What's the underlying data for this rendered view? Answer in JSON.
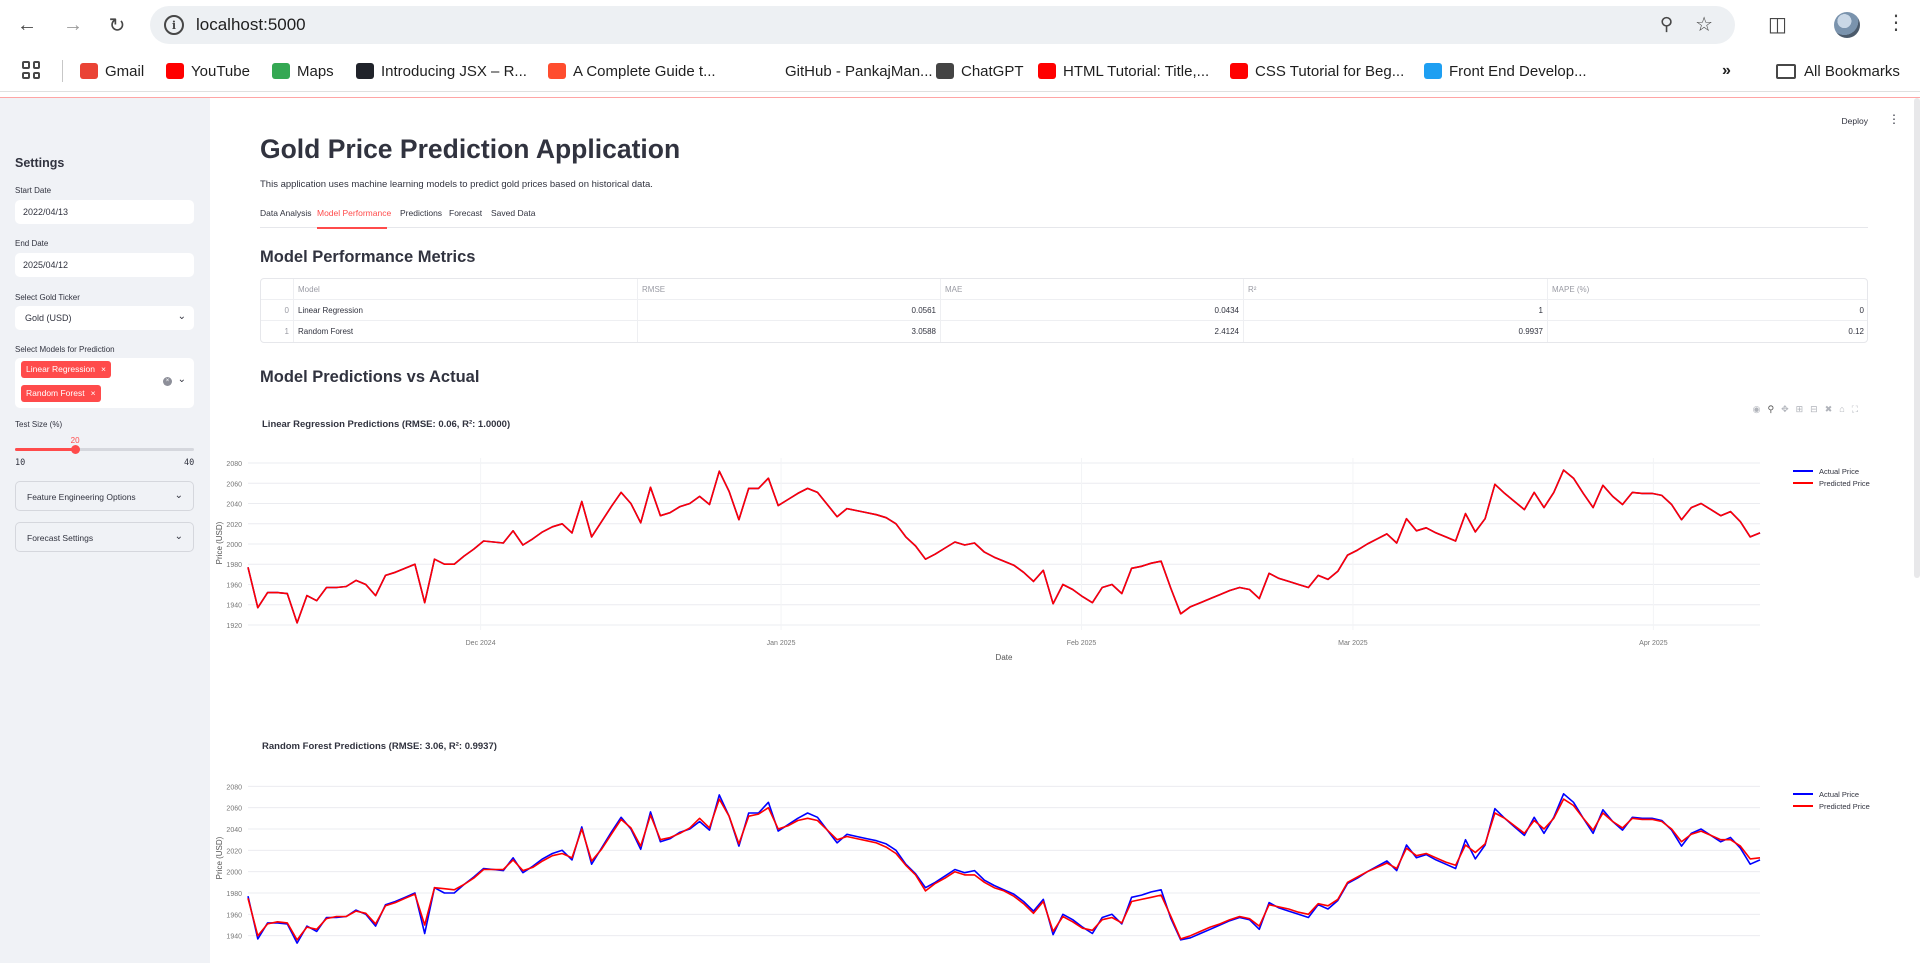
{
  "browser": {
    "url": "localhost:5000",
    "bookmarks": [
      {
        "label": "Gmail",
        "icon": "gmail-icon",
        "color": "#ea4335"
      },
      {
        "label": "YouTube",
        "icon": "youtube-icon",
        "color": "#ff0000"
      },
      {
        "label": "Maps",
        "icon": "maps-icon",
        "color": "#34a853"
      },
      {
        "label": "Introducing JSX – R...",
        "icon": "react-icon",
        "color": "#20232a"
      },
      {
        "label": "A Complete Guide t...",
        "icon": "asterisk-icon",
        "color": "#ff4d2e"
      },
      {
        "label": "GitHub - PankajMan...",
        "icon": "blank-icon",
        "color": "#ffffff"
      },
      {
        "label": "ChatGPT",
        "icon": "chatgpt-icon",
        "color": "#444444"
      },
      {
        "label": "HTML Tutorial: Title,...",
        "icon": "youtube-icon",
        "color": "#ff0000"
      },
      {
        "label": "CSS Tutorial for Beg...",
        "icon": "youtube-icon",
        "color": "#ff0000"
      },
      {
        "label": "Front End Develop...",
        "icon": "is-icon",
        "color": "#1e9ff2"
      }
    ],
    "all_bookmarks": "All Bookmarks"
  },
  "sidebar": {
    "title": "Settings",
    "start_date_label": "Start Date",
    "start_date": "2022/04/13",
    "end_date_label": "End Date",
    "end_date": "2025/04/12",
    "ticker_label": "Select Gold Ticker",
    "ticker": "Gold (USD)",
    "models_label": "Select Models for Prediction",
    "models": [
      "Linear Regression",
      "Random Forest"
    ],
    "test_size_label": "Test Size (%)",
    "test_size": 20,
    "test_size_display": "20",
    "test_size_min": "10",
    "test_size_max": "40",
    "expanders": [
      "Feature Engineering Options",
      "Forecast Settings"
    ]
  },
  "main": {
    "deploy": "Deploy",
    "title": "Gold Price Prediction Application",
    "description": "This application uses machine learning models to predict gold prices based on historical data.",
    "tabs": [
      "Data Analysis",
      "Model Performance",
      "Predictions",
      "Forecast",
      "Saved Data"
    ],
    "active_tab": "Model Performance",
    "metrics_heading": "Model Performance Metrics",
    "table": {
      "columns": [
        "",
        "Model",
        "RMSE",
        "MAE",
        "R²",
        "MAPE (%)"
      ],
      "rows": [
        [
          "0",
          "Linear Regression",
          "0.0561",
          "0.0434",
          "1",
          "0"
        ],
        [
          "1",
          "Random Forest",
          "3.0588",
          "2.4124",
          "0.9937",
          "0.12"
        ]
      ]
    },
    "predictions_heading": "Model Predictions vs Actual"
  },
  "chart_data": [
    {
      "type": "line",
      "title": "Linear Regression Predictions (RMSE: 0.06, R²: 1.0000)",
      "xlabel": "Date",
      "ylabel": "Price (USD)",
      "x_ticks": [
        "Dec 2024",
        "Jan 2025",
        "Feb 2025",
        "Mar 2025",
        "Apr 2025"
      ],
      "y_ticks": [
        1920,
        1940,
        1960,
        1980,
        2000,
        2020,
        2040,
        2060,
        2080
      ],
      "ylim": [
        1915,
        2085
      ],
      "legend": "top-right",
      "x_start": "2024-11-07",
      "x_end": "2025-04-12",
      "series": [
        {
          "name": "Actual Price",
          "color": "#0000ff",
          "values": [
            1977,
            1937,
            1952,
            1952,
            1951,
            1922,
            1949,
            1944,
            1957,
            1957,
            1958,
            1964,
            1960,
            1949,
            1969,
            1972,
            1976,
            1980,
            1942,
            1985,
            1980,
            1980,
            1988,
            1995,
            2003,
            2002,
            2001,
            2013,
            1999,
            2005,
            2012,
            2017,
            2020,
            2011,
            2042,
            2007,
            2022,
            2037,
            2051,
            2040,
            2021,
            2056,
            2028,
            2031,
            2037,
            2040,
            2047,
            2039,
            2072,
            2052,
            2024,
            2055,
            2055,
            2065,
            2038,
            2044,
            2050,
            2055,
            2051,
            2039,
            2027,
            2035,
            2033,
            2031,
            2029,
            2026,
            2020,
            2007,
            1998,
            1985,
            1990,
            1996,
            2002,
            1999,
            2001,
            1992,
            1987,
            1983,
            1979,
            1972,
            1963,
            1974,
            1941,
            1960,
            1955,
            1948,
            1942,
            1957,
            1960,
            1951,
            1976,
            1978,
            1981,
            1983,
            1956,
            1931,
            1938,
            1942,
            1946,
            1950,
            1954,
            1957,
            1955,
            1946,
            1971,
            1966,
            1963,
            1960,
            1957,
            1969,
            1965,
            1973,
            1989,
            1994,
            2000,
            2005,
            2010,
            2001,
            2025,
            2013,
            2016,
            2011,
            2007,
            2003,
            2030,
            2012,
            2025,
            2059,
            2050,
            2042,
            2034,
            2051,
            2036,
            2051,
            2073,
            2065,
            2050,
            2036,
            2058,
            2047,
            2039,
            2051,
            2050,
            2050,
            2048,
            2039,
            2024,
            2036,
            2040,
            2034,
            2028,
            2032,
            2022,
            2007,
            2011
          ]
        },
        {
          "name": "Predicted Price",
          "color": "#ff0000",
          "values": [
            1977,
            1937,
            1952,
            1952,
            1951,
            1922,
            1949,
            1944,
            1957,
            1957,
            1958,
            1964,
            1960,
            1949,
            1969,
            1972,
            1976,
            1980,
            1942,
            1985,
            1980,
            1980,
            1988,
            1995,
            2003,
            2002,
            2001,
            2013,
            1999,
            2005,
            2012,
            2017,
            2020,
            2011,
            2042,
            2007,
            2022,
            2037,
            2051,
            2040,
            2021,
            2056,
            2028,
            2031,
            2037,
            2040,
            2047,
            2039,
            2072,
            2052,
            2024,
            2055,
            2055,
            2065,
            2038,
            2044,
            2050,
            2055,
            2051,
            2039,
            2027,
            2035,
            2033,
            2031,
            2029,
            2026,
            2020,
            2007,
            1998,
            1985,
            1990,
            1996,
            2002,
            1999,
            2001,
            1992,
            1987,
            1983,
            1979,
            1972,
            1963,
            1974,
            1941,
            1960,
            1955,
            1948,
            1942,
            1957,
            1960,
            1951,
            1976,
            1978,
            1981,
            1983,
            1956,
            1931,
            1938,
            1942,
            1946,
            1950,
            1954,
            1957,
            1955,
            1946,
            1971,
            1966,
            1963,
            1960,
            1957,
            1969,
            1965,
            1973,
            1989,
            1994,
            2000,
            2005,
            2010,
            2001,
            2025,
            2013,
            2016,
            2011,
            2007,
            2003,
            2030,
            2012,
            2025,
            2059,
            2050,
            2042,
            2034,
            2051,
            2036,
            2051,
            2073,
            2065,
            2050,
            2036,
            2058,
            2047,
            2039,
            2051,
            2050,
            2050,
            2048,
            2039,
            2024,
            2036,
            2040,
            2034,
            2028,
            2032,
            2022,
            2007,
            2011
          ]
        }
      ]
    },
    {
      "type": "line",
      "title": "Random Forest Predictions (RMSE: 3.06, R²: 0.9937)",
      "xlabel": "",
      "ylabel": "Price (USD)",
      "y_ticks": [
        1940,
        1960,
        1980,
        2000,
        2020,
        2040,
        2060,
        2080
      ],
      "ylim": [
        1935,
        2085
      ],
      "legend": "top-right",
      "x_start": "2024-11-07",
      "x_end": "2025-04-12",
      "series": [
        {
          "name": "Actual Price",
          "color": "#0000ff",
          "values": [
            1977,
            1937,
            1952,
            1952,
            1951,
            1933,
            1949,
            1944,
            1957,
            1957,
            1958,
            1964,
            1960,
            1949,
            1969,
            1972,
            1976,
            1980,
            1942,
            1985,
            1980,
            1980,
            1988,
            1995,
            2003,
            2002,
            2001,
            2013,
            1999,
            2005,
            2012,
            2017,
            2020,
            2011,
            2042,
            2007,
            2022,
            2037,
            2051,
            2040,
            2021,
            2056,
            2028,
            2031,
            2037,
            2040,
            2047,
            2039,
            2072,
            2052,
            2024,
            2055,
            2055,
            2065,
            2038,
            2044,
            2050,
            2055,
            2051,
            2039,
            2027,
            2035,
            2033,
            2031,
            2029,
            2026,
            2020,
            2007,
            1998,
            1985,
            1990,
            1996,
            2002,
            1999,
            2001,
            1992,
            1987,
            1983,
            1979,
            1972,
            1963,
            1974,
            1941,
            1960,
            1955,
            1948,
            1942,
            1957,
            1960,
            1951,
            1976,
            1978,
            1981,
            1983,
            1956,
            1936,
            1938,
            1942,
            1946,
            1950,
            1954,
            1957,
            1955,
            1946,
            1971,
            1966,
            1963,
            1960,
            1957,
            1969,
            1965,
            1973,
            1989,
            1994,
            2000,
            2005,
            2010,
            2001,
            2025,
            2013,
            2016,
            2011,
            2007,
            2003,
            2030,
            2012,
            2025,
            2059,
            2050,
            2042,
            2034,
            2051,
            2036,
            2051,
            2073,
            2065,
            2050,
            2036,
            2058,
            2047,
            2039,
            2051,
            2050,
            2050,
            2048,
            2039,
            2024,
            2036,
            2040,
            2034,
            2028,
            2032,
            2022,
            2007,
            2011
          ]
        },
        {
          "name": "Predicted Price",
          "color": "#ff0000",
          "values": [
            1975,
            1940,
            1951,
            1953,
            1952,
            1936,
            1948,
            1946,
            1956,
            1958,
            1958,
            1963,
            1961,
            1951,
            1968,
            1971,
            1975,
            1979,
            1950,
            1985,
            1984,
            1983,
            1988,
            1994,
            2002,
            2002,
            2002,
            2011,
            2001,
            2004,
            2010,
            2015,
            2017,
            2013,
            2040,
            2010,
            2021,
            2035,
            2049,
            2041,
            2024,
            2053,
            2030,
            2032,
            2036,
            2041,
            2050,
            2041,
            2068,
            2052,
            2026,
            2052,
            2054,
            2060,
            2040,
            2043,
            2048,
            2050,
            2048,
            2039,
            2030,
            2033,
            2031,
            2029,
            2027,
            2023,
            2017,
            2006,
            1997,
            1982,
            1989,
            1994,
            2000,
            1997,
            1997,
            1990,
            1985,
            1982,
            1977,
            1970,
            1961,
            1972,
            1944,
            1958,
            1953,
            1947,
            1945,
            1955,
            1957,
            1952,
            1972,
            1974,
            1976,
            1978,
            1958,
            1937,
            1940,
            1944,
            1948,
            1951,
            1955,
            1958,
            1956,
            1949,
            1969,
            1967,
            1965,
            1962,
            1960,
            1970,
            1968,
            1974,
            1990,
            1995,
            2000,
            2004,
            2008,
            2003,
            2022,
            2015,
            2017,
            2013,
            2009,
            2006,
            2025,
            2018,
            2026,
            2055,
            2050,
            2043,
            2036,
            2048,
            2040,
            2050,
            2068,
            2062,
            2050,
            2039,
            2055,
            2047,
            2041,
            2050,
            2049,
            2049,
            2047,
            2040,
            2028,
            2035,
            2038,
            2034,
            2030,
            2030,
            2024,
            2012,
            2013
          ]
        }
      ]
    }
  ]
}
